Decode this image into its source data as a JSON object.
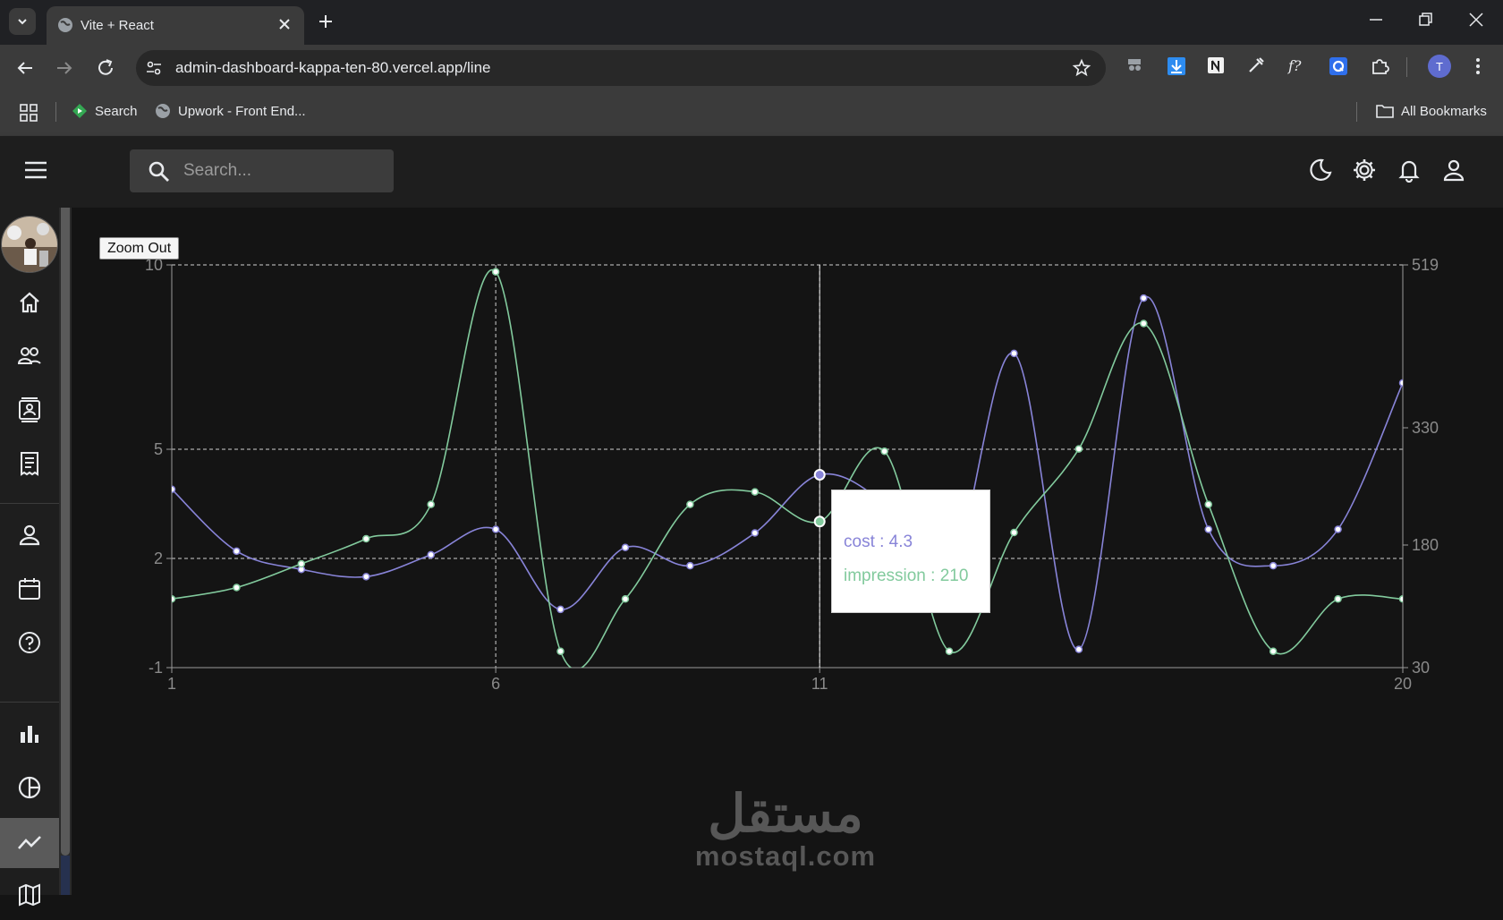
{
  "browser": {
    "tab_title": "Vite + React",
    "url": "admin-dashboard-kappa-ten-80.vercel.app/line",
    "bookmarks": [
      {
        "label": "Search"
      },
      {
        "label": "Upwork - Front End..."
      }
    ],
    "all_bookmarks_label": "All Bookmarks",
    "profile_initial": "T"
  },
  "app": {
    "search_placeholder": "Search...",
    "zoom_out_label": "Zoom Out",
    "sidebar_items": [
      "home-icon",
      "team-icon",
      "contacts-icon",
      "invoices-icon",
      "profile-icon",
      "calendar-icon",
      "faq-icon",
      "bar-chart-icon",
      "pie-chart-icon",
      "line-chart-icon",
      "map-icon"
    ],
    "active_item": "line-chart-icon"
  },
  "chart_data": {
    "type": "line",
    "x": [
      1,
      2,
      3,
      4,
      5,
      6,
      7,
      8,
      9,
      10,
      11,
      12,
      13,
      14,
      15,
      16,
      17,
      18,
      19,
      20
    ],
    "x_ticks": [
      1,
      6,
      11,
      20
    ],
    "series": [
      {
        "name": "cost",
        "axis": "left",
        "color": "#8884d8",
        "values": [
          3.9,
          2.2,
          1.7,
          1.5,
          2.1,
          2.8,
          0.6,
          2.3,
          1.8,
          2.7,
          4.3,
          3.5,
          1.5,
          7.6,
          -0.5,
          9.1,
          2.8,
          1.8,
          2.8,
          6.8
        ]
      },
      {
        "name": "impression",
        "axis": "right",
        "color": "#82ca9d",
        "values": [
          114,
          128,
          157,
          188,
          232,
          511,
          50,
          114,
          232,
          248,
          210,
          300,
          50,
          196,
          303,
          451,
          232,
          50,
          114,
          114
        ]
      }
    ],
    "left_axis": {
      "ylim": [
        -1,
        10
      ],
      "ticks": [
        -1,
        2,
        5,
        10
      ]
    },
    "right_axis": {
      "ylim": [
        30,
        519
      ],
      "ticks": [
        30,
        180,
        330,
        519
      ]
    },
    "grid": true,
    "active_index": 11,
    "tooltip": {
      "cost_label": "cost : 4.3",
      "impression_label": "impression : 210"
    }
  },
  "watermark": {
    "arabic": "مستقل",
    "latin": "mostaql.com"
  }
}
